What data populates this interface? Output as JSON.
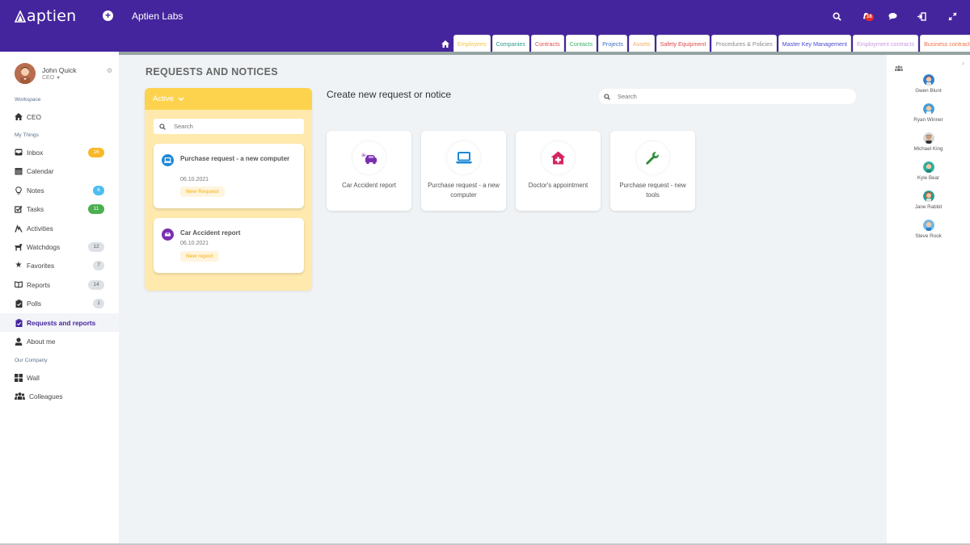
{
  "header": {
    "logo_text": "aptien",
    "company_name": "Aptien Labs",
    "notification_count": "16",
    "icons": [
      "add-icon",
      "search-icon",
      "bell-icon",
      "chat-icon",
      "logout-icon",
      "fullscreen-icon"
    ]
  },
  "tabs": [
    {
      "label": "Employees",
      "color": "#f5c542"
    },
    {
      "label": "Companies",
      "color": "#2a9d8f"
    },
    {
      "label": "Contracts",
      "color": "#e05252"
    },
    {
      "label": "Contacts",
      "color": "#3db36b"
    },
    {
      "label": "Projects",
      "color": "#3f6fc9"
    },
    {
      "label": "Assets",
      "color": "#f5a95c"
    },
    {
      "label": "Safety Equipment",
      "color": "#e04848"
    },
    {
      "label": "Procedures & Policies",
      "color": "#8a8a8a"
    },
    {
      "label": "Master Key Management",
      "color": "#4a4ad0"
    },
    {
      "label": "Employment contracts",
      "color": "#c79be0"
    },
    {
      "label": "Business contracts",
      "color": "#f0704a"
    }
  ],
  "sidebar": {
    "user": {
      "name": "John Quick",
      "role": "CEO"
    },
    "sections": {
      "workspace": "Workspace",
      "my_things": "My Things",
      "our_company": "Our Company"
    },
    "workspace_item": {
      "label": "CEO",
      "icon": "home-icon"
    },
    "items": [
      {
        "label": "Inbox",
        "icon": "inbox-icon",
        "badge": "16",
        "badge_bg": "#f7b928",
        "badge_fg": "#ffffff"
      },
      {
        "label": "Calendar",
        "icon": "calendar-icon"
      },
      {
        "label": "Notes",
        "icon": "lightbulb-icon",
        "badge": "6",
        "badge_bg": "#4cbdf0",
        "badge_fg": "#ffffff"
      },
      {
        "label": "Tasks",
        "icon": "checkbox-icon",
        "badge": "11",
        "badge_bg": "#4caf50",
        "badge_fg": "#ffffff"
      },
      {
        "label": "Activities",
        "icon": "activities-icon"
      },
      {
        "label": "Watchdogs",
        "icon": "dog-icon",
        "badge": "12",
        "badge_bg": "#dde1e5",
        "badge_fg": "#666666"
      },
      {
        "label": "Favorites",
        "icon": "star-icon",
        "badge": "7",
        "badge_bg": "#dde1e5",
        "badge_fg": "#666666"
      },
      {
        "label": "Reports",
        "icon": "book-icon",
        "badge": "14",
        "badge_bg": "#dde1e5",
        "badge_fg": "#666666"
      },
      {
        "label": "Polls",
        "icon": "clipboard-icon",
        "badge": "1",
        "badge_bg": "#dde1e5",
        "badge_fg": "#666666"
      },
      {
        "label": "Requests and reports",
        "icon": "clipboard-check-icon",
        "active": true
      },
      {
        "label": "About me",
        "icon": "user-icon"
      }
    ],
    "company_items": [
      {
        "label": "Wall",
        "icon": "grid-icon"
      },
      {
        "label": "Colleagues",
        "icon": "users-icon"
      }
    ]
  },
  "main": {
    "page_title": "REQUESTS AND NOTICES",
    "column": {
      "filter_label": "Active",
      "search_placeholder": "Search",
      "cards": [
        {
          "title": "Purchase request - a new computer",
          "date": "06.10.2021",
          "tag": "New Request",
          "icon": "laptop-icon",
          "icon_color": "#1e88d6"
        },
        {
          "title": "Car Accident report",
          "date": "06.10.2021",
          "tag": "New report",
          "icon": "car-crash-icon",
          "icon_color": "#7b2fb0"
        }
      ]
    },
    "create_title": "Create new request or notice",
    "search_placeholder": "Search",
    "templates": [
      {
        "label": "Car Accident report",
        "icon": "car-crash-icon",
        "color": "#7b2fb0"
      },
      {
        "label": "Purchase request - a new computer",
        "icon": "laptop-icon",
        "color": "#1e88d6"
      },
      {
        "label": "Doctor's appointment",
        "icon": "clinic-icon",
        "color": "#d6245f"
      },
      {
        "label": "Purchase request - new tools",
        "icon": "wrench-icon",
        "color": "#2e8b3a"
      }
    ]
  },
  "rightbar": {
    "people": [
      {
        "name": "Gwen Blunt",
        "bg": "#2a7fd4",
        "hair": "#b33a2a"
      },
      {
        "name": "Ryan Winner",
        "bg": "#3ea0e0",
        "hair": "#7a4b2a"
      },
      {
        "name": "Michael King",
        "bg": "#d8d8d8",
        "hair": "#3a2a22"
      },
      {
        "name": "Kyle Bear",
        "bg": "#2cb0a0",
        "hair": "#4a2f22"
      },
      {
        "name": "Jane Rabbit",
        "bg": "#2a9d8f",
        "hair": "#c0542e"
      },
      {
        "name": "Steve Rook",
        "bg": "#6ab8ee",
        "hair": "#c98d3c"
      }
    ]
  }
}
